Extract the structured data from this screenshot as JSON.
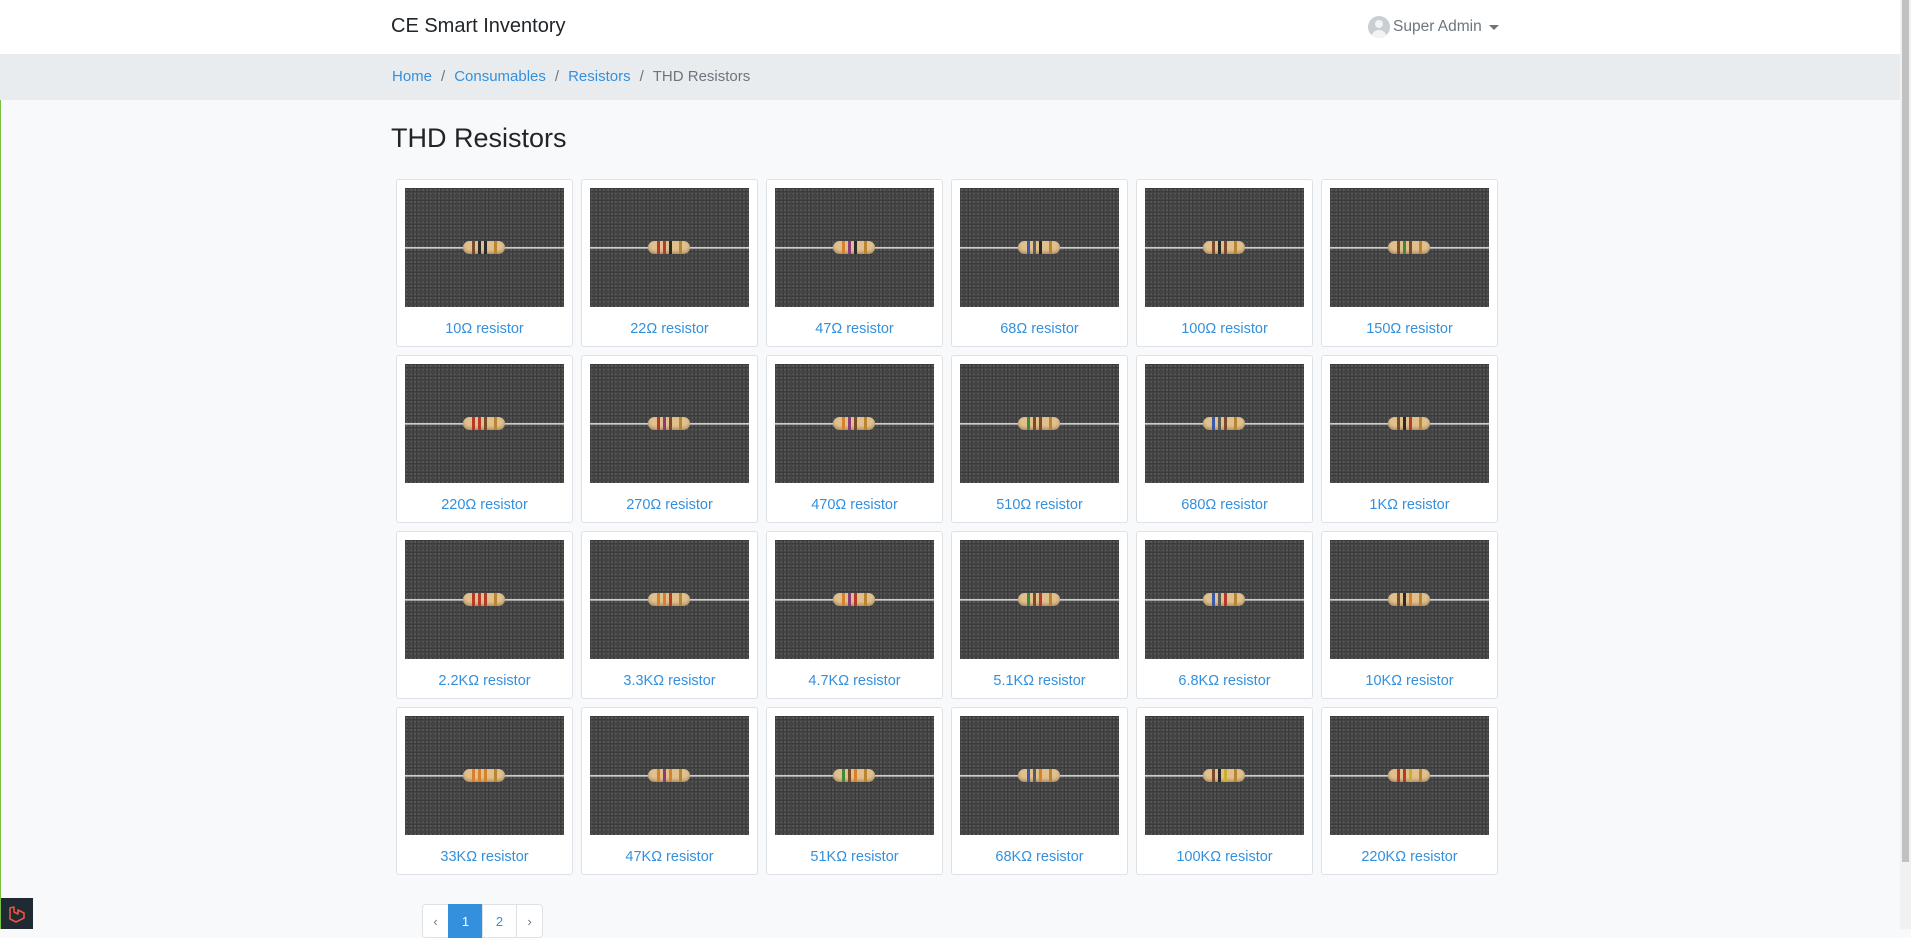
{
  "app": {
    "brand": "CE Smart Inventory"
  },
  "user_menu": {
    "name": "Super Admin",
    "avatar_icon": "user-avatar-icon",
    "caret_icon": "caret-down-icon"
  },
  "breadcrumb": {
    "items": [
      {
        "label": "Home"
      },
      {
        "label": "Consumables"
      },
      {
        "label": "Resistors"
      }
    ],
    "separator": "/",
    "current": "THD Resistors"
  },
  "page": {
    "title": "THD Resistors"
  },
  "items": [
    {
      "label": "10Ω resistor",
      "bands": [
        "#7a4a2a",
        "#2a2a2a",
        "#2a2a2a",
        "#b8862e"
      ]
    },
    {
      "label": "22Ω resistor",
      "bands": [
        "#b53a2a",
        "#b53a2a",
        "#2a2a2a",
        "#b8862e"
      ]
    },
    {
      "label": "47Ω resistor",
      "bands": [
        "#d8812a",
        "#8c3a7a",
        "#2a2a2a",
        "#b8862e"
      ]
    },
    {
      "label": "68Ω resistor",
      "bands": [
        "#3a5aa8",
        "#5a5a5a",
        "#2a2a2a",
        "#b8862e"
      ]
    },
    {
      "label": "100Ω resistor",
      "bands": [
        "#7a4a2a",
        "#2a2a2a",
        "#7a4a2a",
        "#b8862e"
      ]
    },
    {
      "label": "150Ω resistor",
      "bands": [
        "#7a4a2a",
        "#3f8a3a",
        "#7a4a2a",
        "#b8862e"
      ]
    },
    {
      "label": "220Ω resistor",
      "bands": [
        "#b53a2a",
        "#b53a2a",
        "#7a4a2a",
        "#b8862e"
      ]
    },
    {
      "label": "270Ω resistor",
      "bands": [
        "#b53a2a",
        "#8c3a7a",
        "#7a4a2a",
        "#b8862e"
      ]
    },
    {
      "label": "470Ω resistor",
      "bands": [
        "#d8812a",
        "#8c3a7a",
        "#7a4a2a",
        "#b8862e"
      ]
    },
    {
      "label": "510Ω resistor",
      "bands": [
        "#3f8a3a",
        "#7a4a2a",
        "#7a4a2a",
        "#b8862e"
      ]
    },
    {
      "label": "680Ω resistor",
      "bands": [
        "#3a5aa8",
        "#5a5a5a",
        "#7a4a2a",
        "#b8862e"
      ]
    },
    {
      "label": "1KΩ resistor",
      "bands": [
        "#7a4a2a",
        "#2a2a2a",
        "#b53a2a",
        "#b8862e"
      ]
    },
    {
      "label": "2.2KΩ resistor",
      "bands": [
        "#b53a2a",
        "#b53a2a",
        "#b53a2a",
        "#b8862e"
      ]
    },
    {
      "label": "3.3KΩ resistor",
      "bands": [
        "#d8812a",
        "#d8812a",
        "#b53a2a",
        "#b8862e"
      ]
    },
    {
      "label": "4.7KΩ resistor",
      "bands": [
        "#d8812a",
        "#8c3a7a",
        "#b53a2a",
        "#b8862e"
      ]
    },
    {
      "label": "5.1KΩ resistor",
      "bands": [
        "#3f8a3a",
        "#7a4a2a",
        "#b53a2a",
        "#b8862e"
      ]
    },
    {
      "label": "6.8KΩ resistor",
      "bands": [
        "#3a5aa8",
        "#5a5a5a",
        "#b53a2a",
        "#b8862e"
      ]
    },
    {
      "label": "10KΩ resistor",
      "bands": [
        "#7a4a2a",
        "#2a2a2a",
        "#d8812a",
        "#b8862e"
      ]
    },
    {
      "label": "33KΩ resistor",
      "bands": [
        "#d8812a",
        "#d8812a",
        "#d8812a",
        "#b8862e"
      ]
    },
    {
      "label": "47KΩ resistor",
      "bands": [
        "#d8812a",
        "#8c3a7a",
        "#d8812a",
        "#b8862e"
      ]
    },
    {
      "label": "51KΩ resistor",
      "bands": [
        "#3f8a3a",
        "#7a4a2a",
        "#d8812a",
        "#b8862e"
      ]
    },
    {
      "label": "68KΩ resistor",
      "bands": [
        "#3a5aa8",
        "#5a5a5a",
        "#d8812a",
        "#b8862e"
      ]
    },
    {
      "label": "100KΩ resistor",
      "bands": [
        "#7a4a2a",
        "#2a2a2a",
        "#c9b02a",
        "#b8862e"
      ]
    },
    {
      "label": "220KΩ resistor",
      "bands": [
        "#b53a2a",
        "#b53a2a",
        "#c9b02a",
        "#b8862e"
      ]
    }
  ],
  "pagination": {
    "prev": "‹",
    "pages": [
      "1",
      "2"
    ],
    "current_page": "1",
    "next": "›"
  },
  "colors": {
    "link": "#3490dc",
    "crumb_bg": "#e9ecef",
    "page_bg": "#f8f9fa",
    "active_page": "#3490dc"
  },
  "debug_badge": {
    "icon": "laravel-icon"
  }
}
